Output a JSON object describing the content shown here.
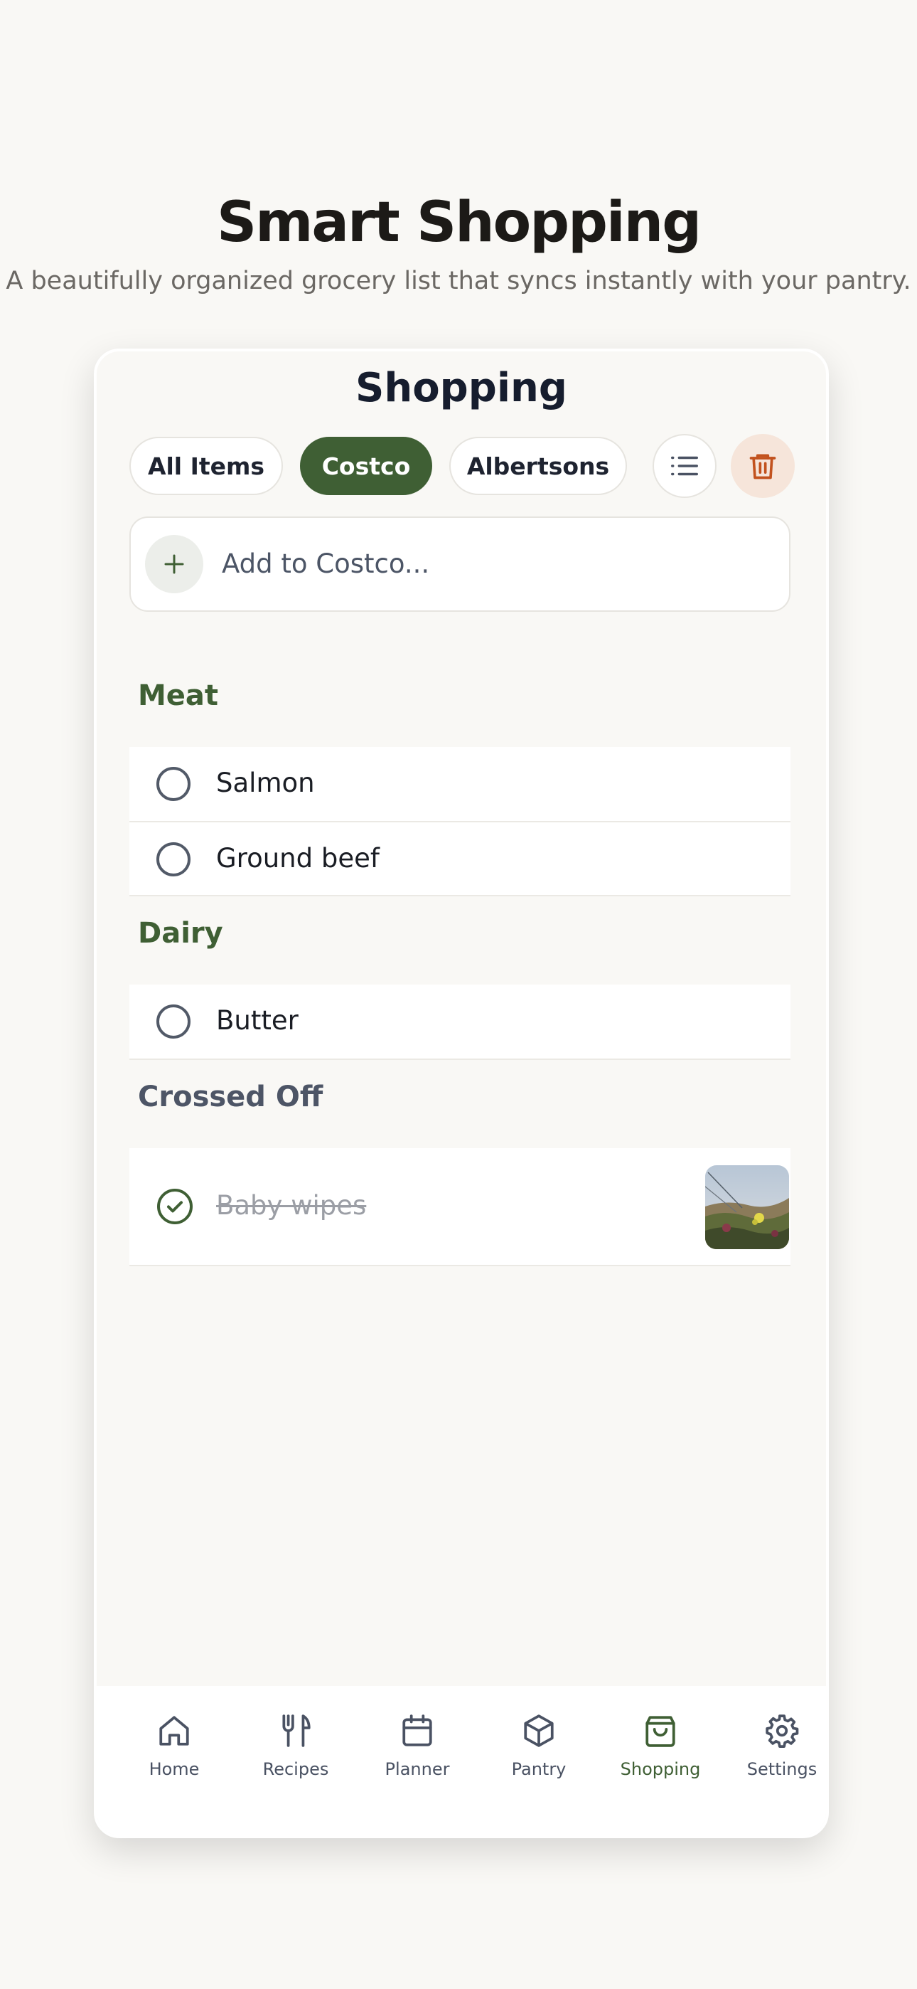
{
  "hero": {
    "title": "Smart Shopping",
    "subtitle": "A beautifully organized grocery list that syncs instantly with your pantry."
  },
  "screen": {
    "title": "Shopping"
  },
  "filters": {
    "chips": [
      "All Items",
      "Costco",
      "Albertsons"
    ],
    "active": "Costco",
    "list_icon": "list-icon",
    "trash_icon": "trash-icon"
  },
  "add_field": {
    "placeholder": "Add to Costco...",
    "icon": "plus-icon"
  },
  "sections": [
    {
      "title": "Meat",
      "items": [
        "Salmon",
        "Ground beef"
      ]
    },
    {
      "title": "Dairy",
      "items": [
        "Butter"
      ]
    },
    {
      "title": "Crossed Off",
      "items": [
        "Baby wipes"
      ]
    }
  ],
  "tabbar": {
    "tabs": [
      {
        "label": "Home",
        "icon": "home-icon"
      },
      {
        "label": "Recipes",
        "icon": "utensils-icon"
      },
      {
        "label": "Planner",
        "icon": "calendar-icon"
      },
      {
        "label": "Pantry",
        "icon": "box-icon"
      },
      {
        "label": "Shopping",
        "icon": "shopping-bag-icon"
      },
      {
        "label": "Settings",
        "icon": "gear-icon"
      }
    ],
    "active": "Shopping"
  },
  "colors": {
    "accent": "#3f5f34",
    "danger": "#c2521e",
    "background": "#f9f8f5"
  }
}
